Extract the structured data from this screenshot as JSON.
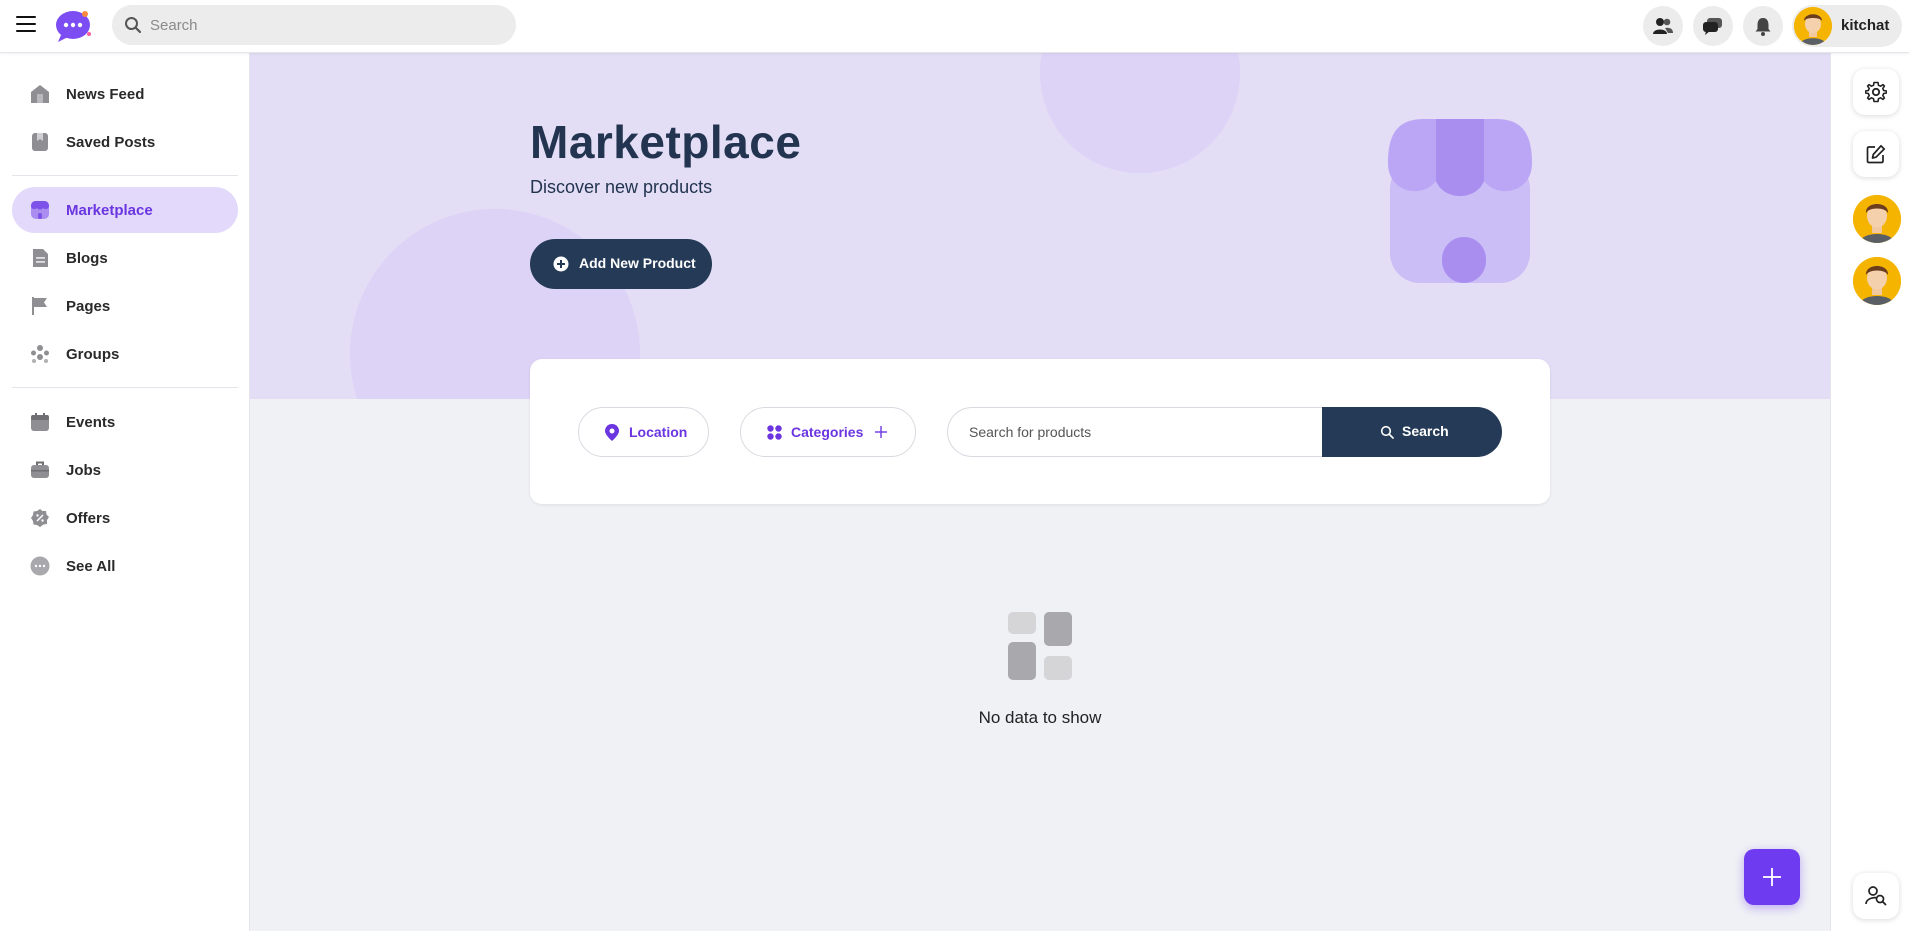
{
  "topbar": {
    "search_placeholder": "Search",
    "username": "kitchat"
  },
  "sidebar": {
    "items": [
      {
        "label": "News Feed",
        "icon": "home-icon"
      },
      {
        "label": "Saved Posts",
        "icon": "bookmark-icon"
      },
      {
        "label": "Marketplace",
        "icon": "store-icon",
        "active": true
      },
      {
        "label": "Blogs",
        "icon": "document-icon"
      },
      {
        "label": "Pages",
        "icon": "flag-icon"
      },
      {
        "label": "Groups",
        "icon": "groups-icon"
      },
      {
        "label": "Events",
        "icon": "calendar-icon"
      },
      {
        "label": "Jobs",
        "icon": "briefcase-icon"
      },
      {
        "label": "Offers",
        "icon": "percent-badge-icon"
      },
      {
        "label": "See All",
        "icon": "more-dots-icon"
      }
    ]
  },
  "hero": {
    "title": "Marketplace",
    "subtitle": "Discover new products",
    "add_button": "Add New Product"
  },
  "filters": {
    "location_label": "Location",
    "categories_label": "Categories",
    "search_placeholder": "Search for products",
    "search_button": "Search"
  },
  "empty_state": {
    "text": "No data to show"
  },
  "colors": {
    "accent": "#6b36e0",
    "navy": "#253a56",
    "hero_bg": "#e3ddf6",
    "active_nav_bg": "#e2d9fb",
    "fab": "#6e3bf0"
  }
}
